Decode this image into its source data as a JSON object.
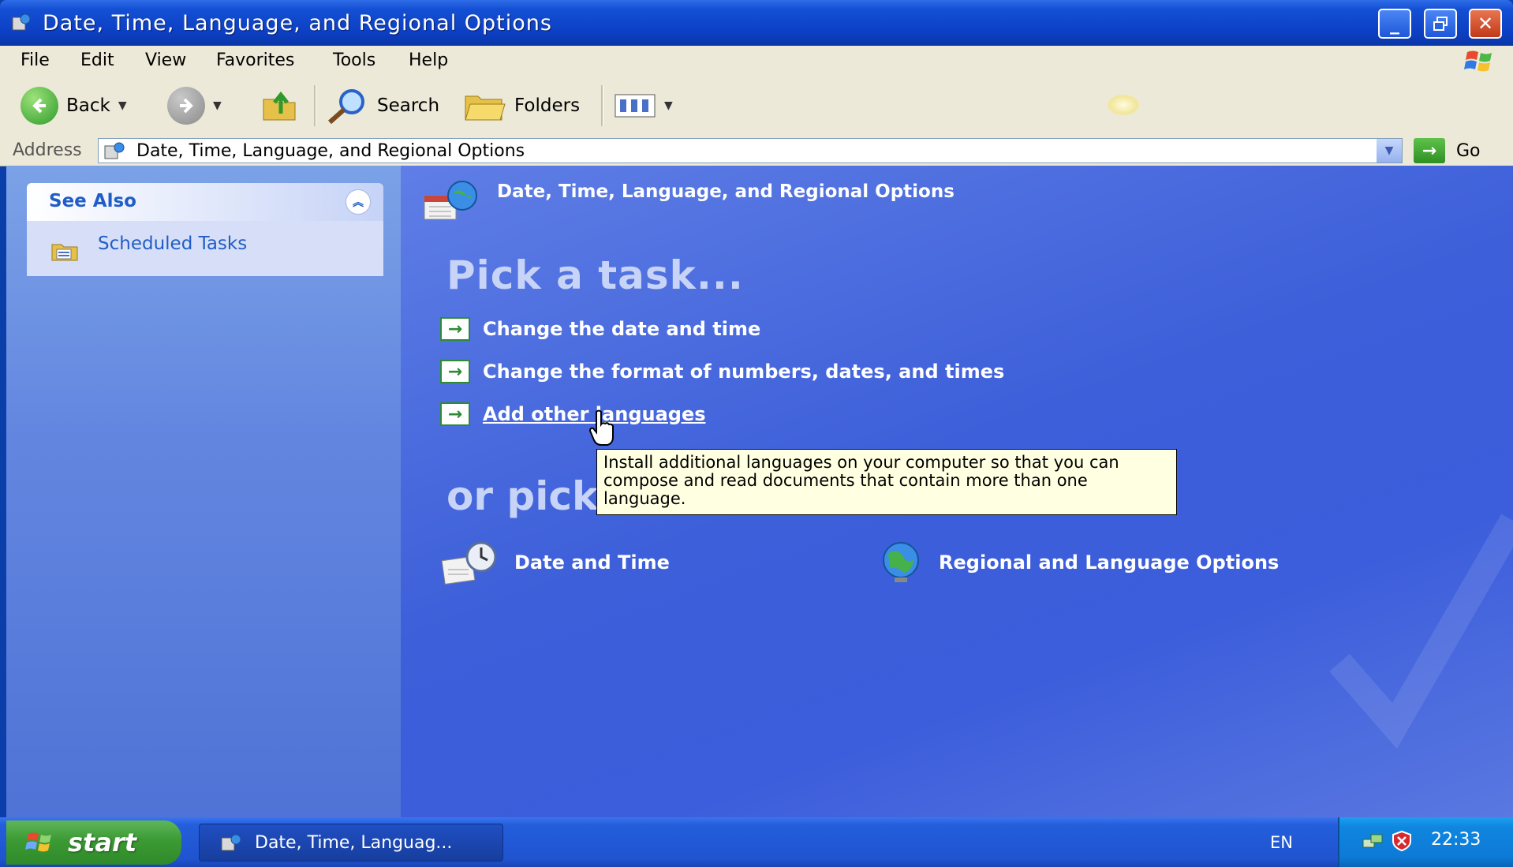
{
  "window": {
    "title": "Date, Time, Language, and Regional Options",
    "buttons": {
      "minimize_icon": "minimize-icon",
      "maximize_icon": "restore-icon",
      "close_icon": "close-icon"
    }
  },
  "menubar": [
    "File",
    "Edit",
    "View",
    "Favorites",
    "Tools",
    "Help"
  ],
  "toolbar": {
    "back_label": "Back",
    "search_label": "Search",
    "folders_label": "Folders"
  },
  "address": {
    "label": "Address",
    "value": "Date, Time, Language, and Regional Options",
    "go_label": "Go"
  },
  "sidebar": {
    "see_also_title": "See Also",
    "items": [
      {
        "label": "Scheduled Tasks",
        "icon": "scheduled-tasks-icon"
      }
    ]
  },
  "main": {
    "category_title": "Date, Time, Language, and Regional Options",
    "pick_task_title": "Pick a task...",
    "tasks": [
      {
        "label": "Change the date and time"
      },
      {
        "label": "Change the format of numbers, dates, and times"
      },
      {
        "label": "Add other languages"
      }
    ],
    "or_pick_title": "or pick",
    "icons": [
      {
        "label": "Date and Time",
        "icon": "date-time-icon"
      },
      {
        "label": "Regional and Language Options",
        "icon": "globe-icon"
      }
    ],
    "tooltip": "Install additional languages on your computer so that you can compose and read documents that contain more than one language."
  },
  "taskbar": {
    "start_label": "start",
    "task_button_label": "Date, Time, Languag...",
    "language": "EN",
    "clock": "22:33"
  },
  "colors": {
    "titlebar": "#0c3fc4",
    "main_pane": "#3d5fd9",
    "sidebar": "#6387e0",
    "task_arrow": "#2e8a34",
    "tooltip_bg": "#ffffe1"
  }
}
